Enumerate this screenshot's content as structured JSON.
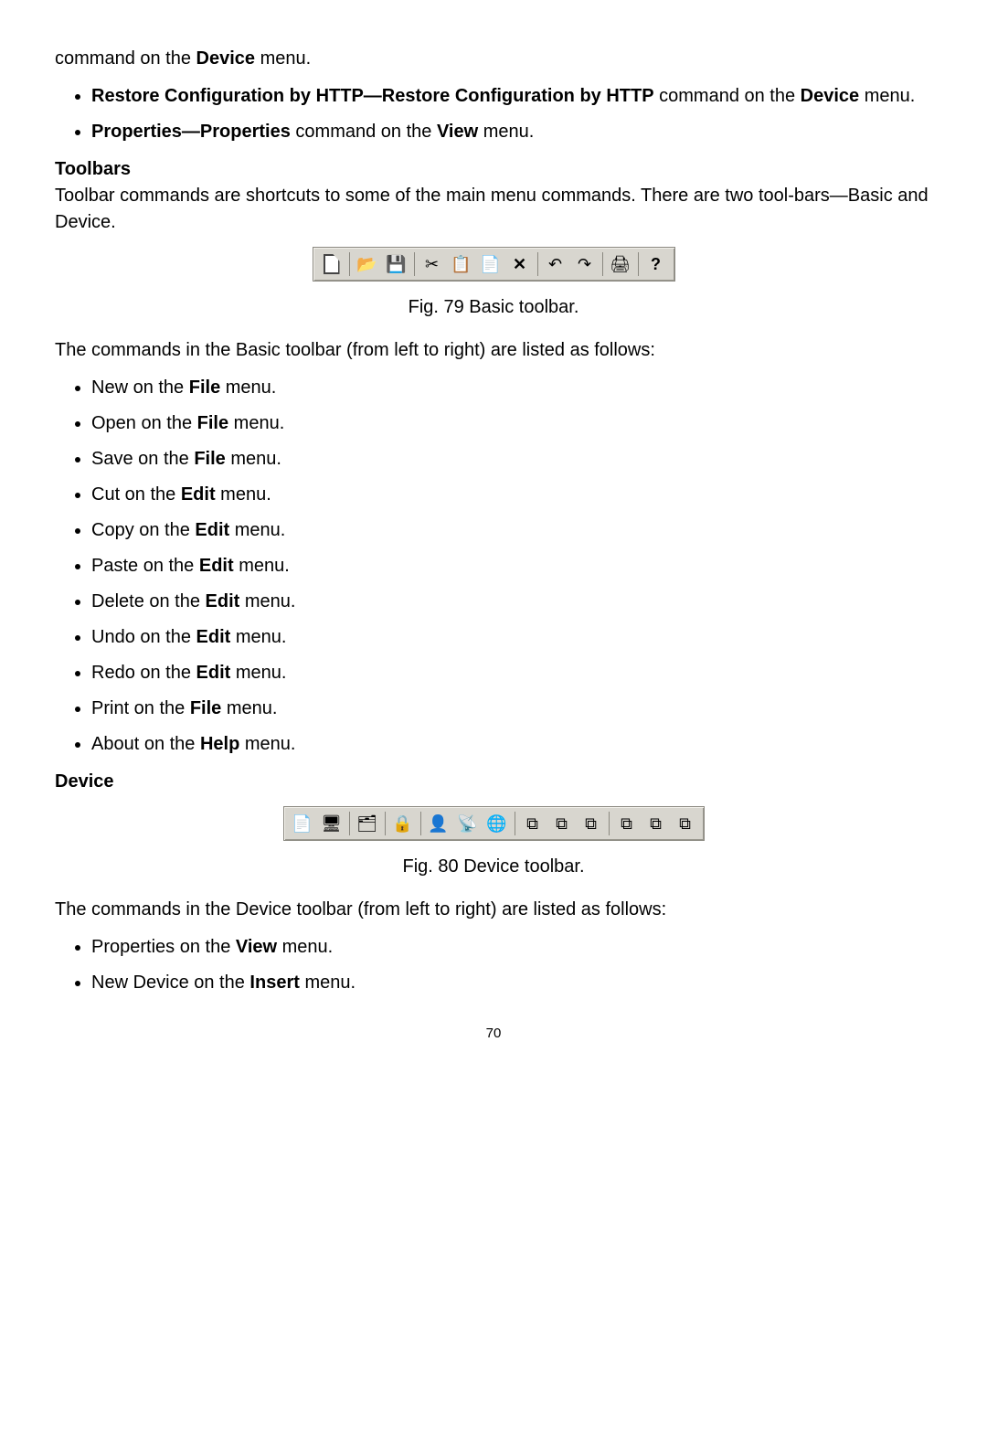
{
  "intro_tail": {
    "pre": "command on the ",
    "bold": "Device",
    "post": " menu."
  },
  "top_bullets": [
    {
      "b1": "Restore Configuration by HTTP—Restore Configuration by HTTP",
      "mid": " command on the ",
      "b2": "Device",
      "post": " menu."
    },
    {
      "b1": "Properties—Properties",
      "mid": " command on the ",
      "b2": "View",
      "post": " menu."
    }
  ],
  "toolbars_heading": "Toolbars",
  "toolbars_intro": "Toolbar commands are shortcuts to some of the main menu commands. There are two tool-bars—Basic and Device.",
  "fig79": "Fig. 79 Basic toolbar.",
  "basic_intro": "The commands in the Basic toolbar (from left to right) are listed as follows:",
  "basic_list": [
    {
      "pre": "New on the ",
      "b": "File",
      "post": " menu."
    },
    {
      "pre": "Open on the ",
      "b": "File",
      "post": " menu."
    },
    {
      "pre": "Save on the ",
      "b": "File",
      "post": " menu."
    },
    {
      "pre": "Cut on the ",
      "b": "Edit",
      "post": " menu."
    },
    {
      "pre": "Copy on the ",
      "b": "Edit",
      "post": " menu."
    },
    {
      "pre": "Paste on the ",
      "b": "Edit",
      "post": " menu."
    },
    {
      "pre": "Delete on the ",
      "b": "Edit",
      "post": " menu."
    },
    {
      "pre": "Undo on the ",
      "b": "Edit",
      "post": " menu."
    },
    {
      "pre": "Redo on the ",
      "b": "Edit",
      "post": " menu."
    },
    {
      "pre": "Print on the ",
      "b": "File",
      "post": " menu."
    },
    {
      "pre": "About on the ",
      "b": "Help",
      "post": " menu."
    }
  ],
  "device_heading": "Device",
  "fig80": "Fig. 80 Device toolbar.",
  "device_intro": "The commands in the Device toolbar (from left to right) are listed as follows:",
  "device_list": [
    {
      "pre": "Properties on the ",
      "b": "View",
      "post": " menu."
    },
    {
      "pre": "New Device on the ",
      "b": "Insert",
      "post": " menu."
    }
  ],
  "page_number": "70",
  "basic_toolbar_icons": [
    "new",
    "open",
    "save",
    "cut",
    "copy",
    "paste",
    "delete",
    "undo",
    "redo",
    "print",
    "help"
  ],
  "device_toolbar_icons": [
    "prop",
    "newdev",
    "dup",
    "lock",
    "user",
    "conn",
    "net",
    "d1",
    "d2",
    "d3",
    "d4",
    "d5",
    "d6"
  ]
}
